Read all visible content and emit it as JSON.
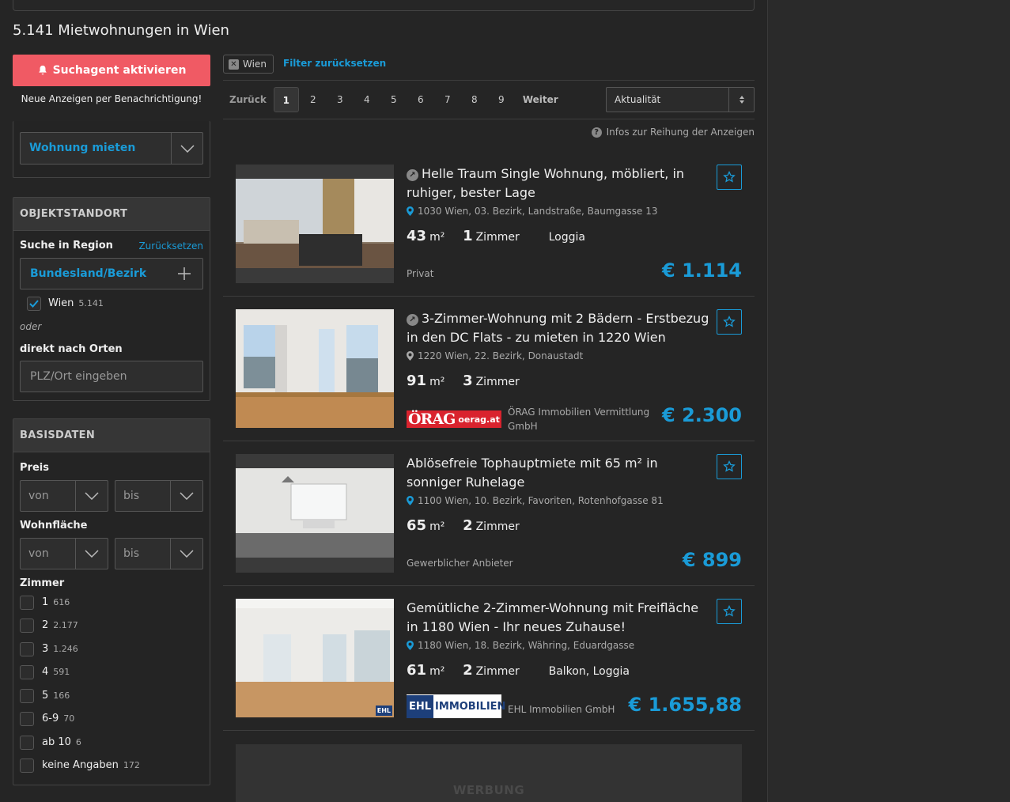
{
  "page_title": "5.141 Mietwohnungen in Wien",
  "sidebar": {
    "agent_button": "Suchagent aktivieren",
    "agent_sub": "Neue Anzeigen per Benachrichtigung!",
    "category_select": "Wohnung mieten",
    "location": {
      "header": "OBJEKTSTANDORT",
      "region_label": "Suche in Region",
      "reset": "Zurücksetzen",
      "region_select": "Bundesland/Bezirk",
      "selected_region": "Wien",
      "selected_count": "5.141",
      "oder": "oder",
      "direct_label": "direkt nach Orten",
      "direct_placeholder": "PLZ/Ort eingeben"
    },
    "basics": {
      "header": "BASISDATEN",
      "price_label": "Preis",
      "area_label": "Wohnfläche",
      "von": "von",
      "bis": "bis",
      "rooms_label": "Zimmer",
      "rooms": [
        {
          "label": "1",
          "count": "616"
        },
        {
          "label": "2",
          "count": "2.177"
        },
        {
          "label": "3",
          "count": "1.246"
        },
        {
          "label": "4",
          "count": "591"
        },
        {
          "label": "5",
          "count": "166"
        },
        {
          "label": "6-9",
          "count": "70"
        },
        {
          "label": "ab 10",
          "count": "6"
        },
        {
          "label": "keine Angaben",
          "count": "172"
        }
      ]
    }
  },
  "filters": {
    "chip": "Wien",
    "reset": "Filter zurücksetzen"
  },
  "pager": {
    "prev": "Zurück",
    "pages": [
      "1",
      "2",
      "3",
      "4",
      "5",
      "6",
      "7",
      "8",
      "9"
    ],
    "next": "Weiter",
    "sort": "Aktualität"
  },
  "info_line": "Infos zur Reihung der Anzeigen",
  "listings": [
    {
      "title": "Helle Traum Single Wohnung, möbliert, in ruhiger, bester Lage",
      "address": "1030 Wien, 03. Bezirk, Landstraße, Baumgasse 13",
      "area": "43",
      "area_unit": "m²",
      "rooms": "1",
      "rooms_unit": "Zimmer",
      "extra": "Loggia",
      "seller": "Privat",
      "price": "€ 1.114"
    },
    {
      "title": "3-Zimmer-Wohnung mit 2 Bädern - Erstbezug in den DC Flats - zu mieten in 1220 Wien",
      "address": "1220 Wien, 22. Bezirk, Donaustadt",
      "area": "91",
      "area_unit": "m²",
      "rooms": "3",
      "rooms_unit": "Zimmer",
      "seller": "ÖRAG Immobilien Vermittlung GmbH",
      "logo_text": "ÖRAG",
      "logo_sub": "oerag.at",
      "price": "€ 2.300"
    },
    {
      "title": "Ablösefreie Tophauptmiete mit 65 m² in sonniger Ruhelage",
      "address": "1100 Wien, 10. Bezirk, Favoriten, Rotenhofgasse 81",
      "area": "65",
      "area_unit": "m²",
      "rooms": "2",
      "rooms_unit": "Zimmer",
      "seller": "Gewerblicher Anbieter",
      "price": "€ 899"
    },
    {
      "title": "Gemütliche 2-Zimmer-Wohnung mit Freifläche in 1180 Wien - Ihr neues Zuhause!",
      "address": "1180 Wien, 18. Bezirk, Währing, Eduardgasse",
      "area": "61",
      "area_unit": "m²",
      "rooms": "2",
      "rooms_unit": "Zimmer",
      "extra": "Balkon, Loggia",
      "seller": "EHL Immobilien GmbH",
      "logo_text": "EHL",
      "logo_sub": "IMMOBILIEN",
      "thumb_mark": "EHL",
      "price": "€ 1.655,88"
    }
  ],
  "ad_label": "WERBUNG",
  "colors": {
    "accent": "#1a9bd7",
    "agent_button": "#f05a64"
  }
}
